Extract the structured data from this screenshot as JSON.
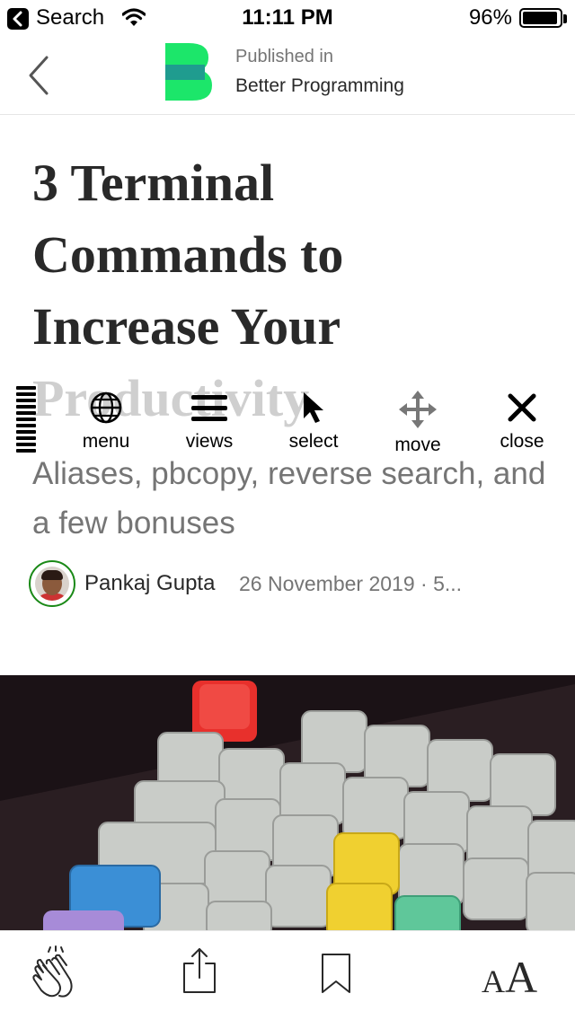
{
  "status_bar": {
    "back_app": "Search",
    "time": "11:11 PM",
    "battery": "96%",
    "battery_level": 0.96
  },
  "nav": {
    "published_in": "Published in",
    "publication": "Better Programming",
    "logo_letter": "B"
  },
  "article": {
    "title_lines": [
      "3 Terminal",
      "Commands to",
      "Increase Your",
      "Productivity"
    ],
    "subtitle": "Aliases, pbcopy, reverse search, and a few bonuses",
    "author": "Pankaj Gupta",
    "meta": "26 November 2019 · 5..."
  },
  "overlay_toolbar": {
    "items": [
      {
        "label": "menu",
        "icon": "globe-icon"
      },
      {
        "label": "views",
        "icon": "hamburger-icon"
      },
      {
        "label": "select",
        "icon": "cursor-arrow-icon"
      },
      {
        "label": "move",
        "icon": "move-arrows-icon"
      },
      {
        "label": "close",
        "icon": "close-x-icon"
      }
    ]
  },
  "bottom_bar": {
    "items": [
      {
        "icon": "clap-icon"
      },
      {
        "icon": "share-icon"
      },
      {
        "icon": "bookmark-icon"
      },
      {
        "icon": "font-size-icon",
        "label_small": "A",
        "label_big": "A"
      }
    ]
  },
  "colors": {
    "logo_green": "#1ce66a",
    "logo_teal": "#1f9c8f",
    "avatar_ring": "#1a8917",
    "text_dark": "#292929",
    "text_muted": "#757575"
  }
}
